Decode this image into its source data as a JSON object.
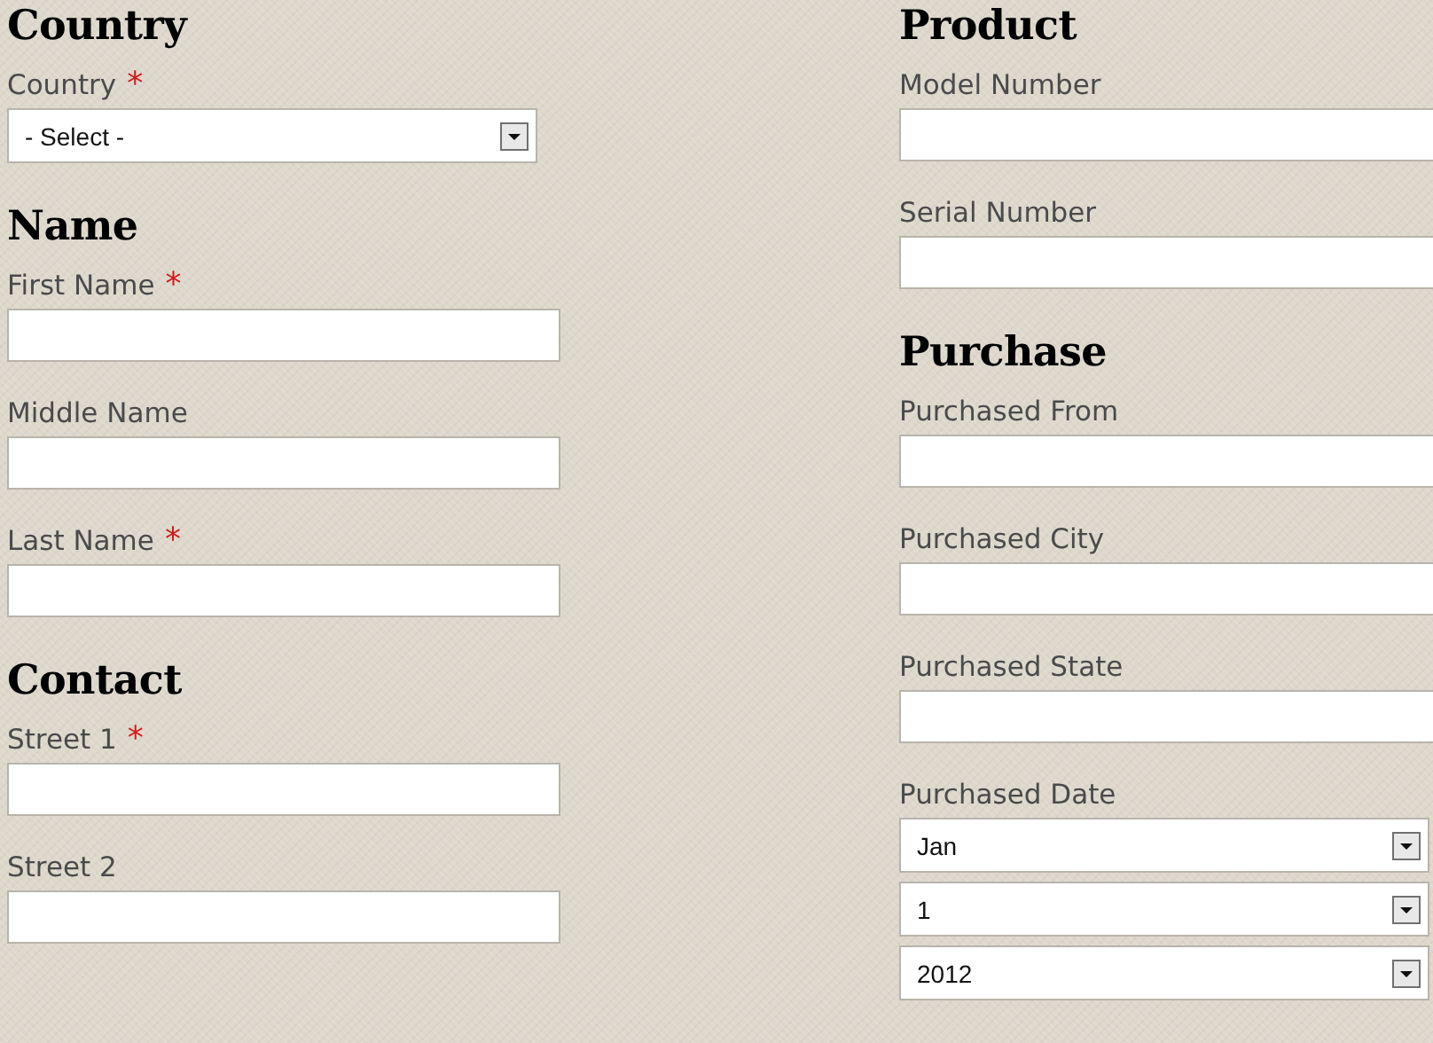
{
  "columns": [
    {
      "sections": [
        {
          "heading": "Country",
          "fields": [
            {
              "kind": "select",
              "label": "Country",
              "required_mark": "*",
              "value": "- Select -"
            }
          ]
        },
        {
          "heading": "Name",
          "fields": [
            {
              "kind": "text",
              "label": "First Name",
              "required_mark": "*"
            },
            {
              "kind": "text",
              "label": "Middle Name"
            },
            {
              "kind": "text",
              "label": "Last Name",
              "required_mark": "*"
            }
          ]
        },
        {
          "heading": "Contact",
          "fields": [
            {
              "kind": "text",
              "label": "Street 1",
              "required_mark": "*"
            },
            {
              "kind": "text",
              "label": "Street 2"
            }
          ]
        }
      ]
    },
    {
      "sections": [
        {
          "heading": "Product",
          "fields": [
            {
              "kind": "text",
              "label": "Model Number"
            },
            {
              "kind": "text",
              "label": "Serial Number"
            }
          ]
        },
        {
          "heading": "Purchase",
          "fields": [
            {
              "kind": "text",
              "label": "Purchased From"
            },
            {
              "kind": "text",
              "label": "Purchased City"
            },
            {
              "kind": "text",
              "label": "Purchased State"
            },
            {
              "kind": "date",
              "label": "Purchased Date",
              "selects": [
                "Jan",
                "1",
                "2012"
              ]
            }
          ]
        }
      ]
    }
  ]
}
